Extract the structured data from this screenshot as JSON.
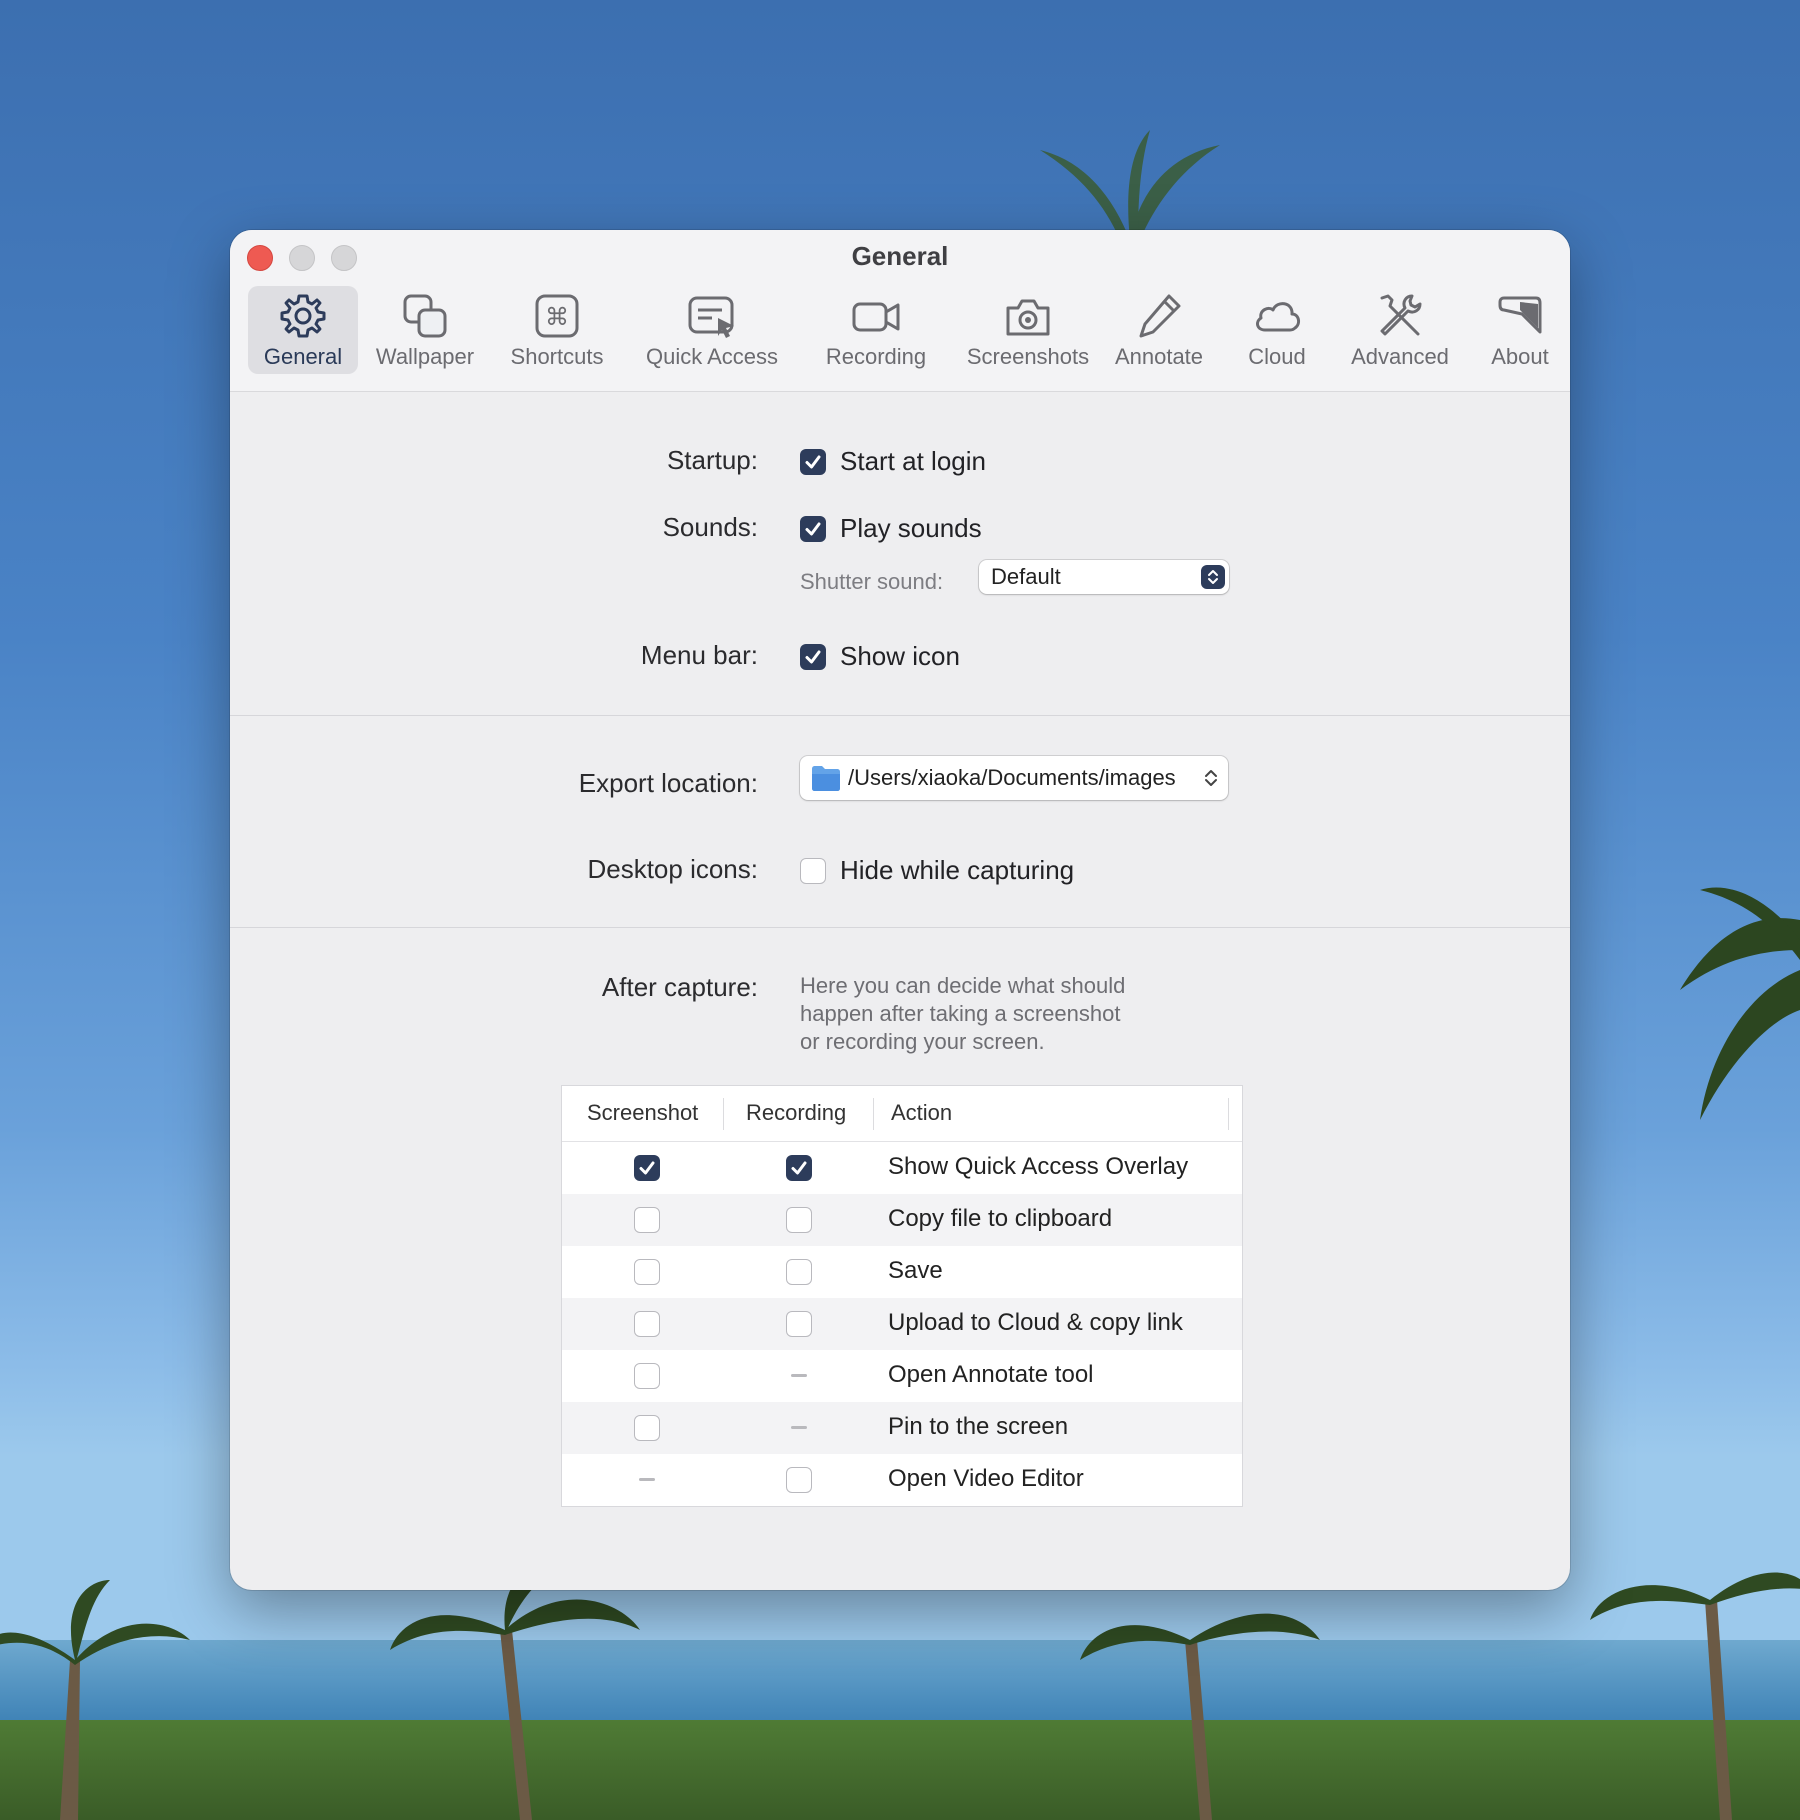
{
  "window": {
    "title": "General"
  },
  "toolbar": {
    "tabs": [
      {
        "label": "General",
        "icon": "gear-icon",
        "active": true
      },
      {
        "label": "Wallpaper",
        "icon": "wallpaper-icon",
        "active": false
      },
      {
        "label": "Shortcuts",
        "icon": "command-key-icon",
        "active": false
      },
      {
        "label": "Quick Access",
        "icon": "quick-access-icon",
        "active": false
      },
      {
        "label": "Recording",
        "icon": "video-camera-icon",
        "active": false
      },
      {
        "label": "Screenshots",
        "icon": "camera-icon",
        "active": false
      },
      {
        "label": "Annotate",
        "icon": "pen-icon",
        "active": false
      },
      {
        "label": "Cloud",
        "icon": "cloud-icon",
        "active": false
      },
      {
        "label": "Advanced",
        "icon": "tools-icon",
        "active": false
      },
      {
        "label": "About",
        "icon": "about-icon",
        "active": false
      }
    ]
  },
  "general": {
    "startup_label": "Startup:",
    "start_at_login": {
      "label": "Start at login",
      "checked": true
    },
    "sounds_label": "Sounds:",
    "play_sounds": {
      "label": "Play sounds",
      "checked": true
    },
    "shutter_sound_label": "Shutter sound:",
    "shutter_sound_value": "Default",
    "menubar_label": "Menu bar:",
    "show_icon": {
      "label": "Show icon",
      "checked": true
    }
  },
  "export": {
    "location_label": "Export location:",
    "location_value": "/Users/xiaoka/Documents/images",
    "desktop_icons_label": "Desktop icons:",
    "hide_while_capturing": {
      "label": "Hide while capturing",
      "checked": false
    }
  },
  "after_capture": {
    "label": "After capture:",
    "description_lines": [
      "Here you can decide what should",
      "happen after taking a screenshot",
      "or recording your screen."
    ],
    "columns": [
      "Screenshot",
      "Recording",
      "Action"
    ],
    "rows": [
      {
        "screenshot": "checked",
        "recording": "checked",
        "action": "Show Quick Access Overlay"
      },
      {
        "screenshot": "unchecked",
        "recording": "unchecked",
        "action": "Copy file to clipboard"
      },
      {
        "screenshot": "unchecked",
        "recording": "unchecked",
        "action": "Save"
      },
      {
        "screenshot": "unchecked",
        "recording": "unchecked",
        "action": "Upload to Cloud & copy link"
      },
      {
        "screenshot": "unchecked",
        "recording": "na",
        "action": "Open Annotate tool"
      },
      {
        "screenshot": "unchecked",
        "recording": "na",
        "action": "Pin to the screen"
      },
      {
        "screenshot": "na",
        "recording": "unchecked",
        "action": "Open Video Editor"
      }
    ]
  },
  "colors": {
    "accent": "#2d3c5b",
    "close_button": "#ee5a52",
    "window_background": "#eeeef0"
  }
}
